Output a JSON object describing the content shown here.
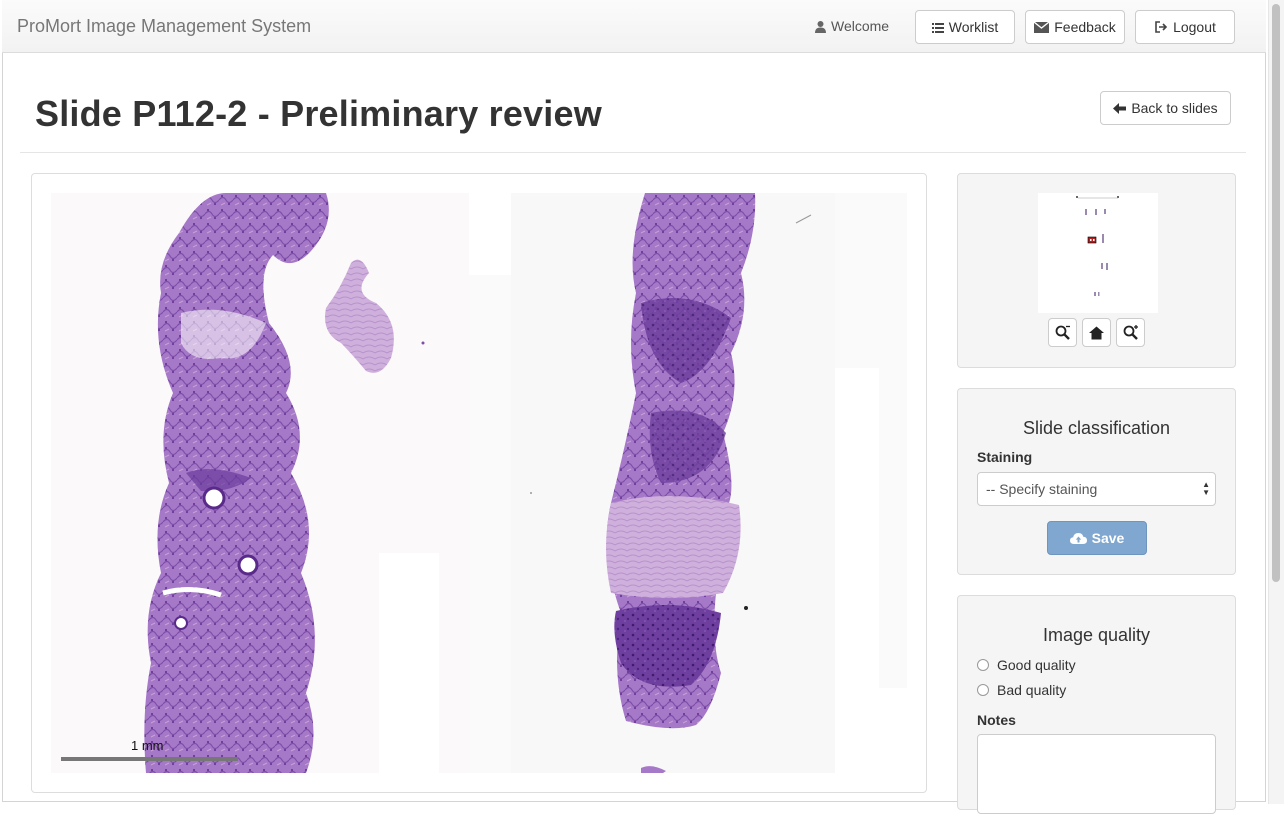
{
  "navbar": {
    "brand": "ProMort Image Management System",
    "welcome": "Welcome",
    "worklist": "Worklist",
    "feedback": "Feedback",
    "logout": "Logout"
  },
  "page": {
    "title": "Slide P112-2 - Preliminary review",
    "back_label": "Back to slides"
  },
  "viewer": {
    "scale_label": "1 mm",
    "navigator_icons": [
      "zoom-out-icon",
      "home-icon",
      "zoom-in-icon"
    ]
  },
  "classification": {
    "title": "Slide classification",
    "staining_label": "Staining",
    "staining_selected": "-- Specify staining",
    "save_label": "Save",
    "save_color": "#7fa7cf"
  },
  "quality": {
    "title": "Image quality",
    "options": [
      "Good quality",
      "Bad quality"
    ],
    "notes_label": "Notes",
    "notes_value": ""
  }
}
